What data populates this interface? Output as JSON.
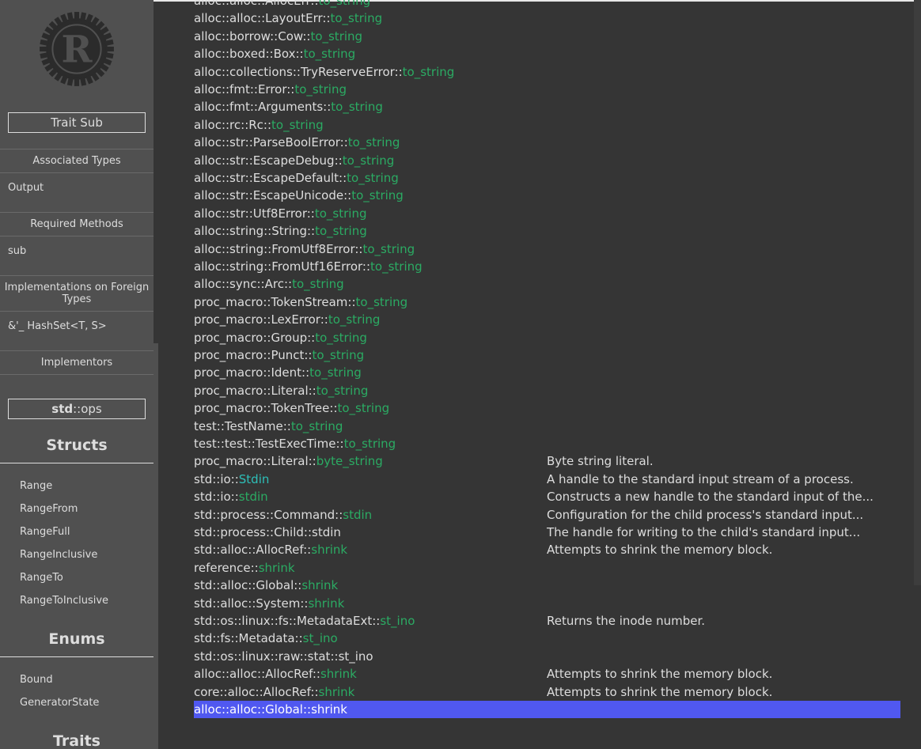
{
  "sidebar": {
    "trait_title": "Trait Sub",
    "sections": [
      {
        "heading": "Associated Types",
        "items": [
          "Output"
        ]
      },
      {
        "heading": "Required Methods",
        "items": [
          "sub"
        ]
      },
      {
        "heading": "Implementations on Foreign Types",
        "items": [
          "&'_ HashSet<T, S>"
        ]
      },
      {
        "heading": "Implementors",
        "items": []
      }
    ],
    "module_prefix": "std",
    "module_sep": "::",
    "module_name": "ops",
    "structs_heading": "Structs",
    "structs": [
      "Range",
      "RangeFrom",
      "RangeFull",
      "RangeInclusive",
      "RangeTo",
      "RangeToInclusive"
    ],
    "enums_heading": "Enums",
    "enums": [
      "Bound",
      "GeneratorState"
    ],
    "traits_heading": "Traits"
  },
  "results": [
    {
      "path": "alloc::alloc::AllocErr::",
      "name": "to_string",
      "kind": "fn",
      "desc": ""
    },
    {
      "path": "alloc::alloc::LayoutErr::",
      "name": "to_string",
      "kind": "fn",
      "desc": ""
    },
    {
      "path": "alloc::borrow::Cow::",
      "name": "to_string",
      "kind": "fn",
      "desc": ""
    },
    {
      "path": "alloc::boxed::Box::",
      "name": "to_string",
      "kind": "fn",
      "desc": ""
    },
    {
      "path": "alloc::collections::TryReserveError::",
      "name": "to_string",
      "kind": "fn",
      "desc": ""
    },
    {
      "path": "alloc::fmt::Error::",
      "name": "to_string",
      "kind": "fn",
      "desc": ""
    },
    {
      "path": "alloc::fmt::Arguments::",
      "name": "to_string",
      "kind": "fn",
      "desc": ""
    },
    {
      "path": "alloc::rc::Rc::",
      "name": "to_string",
      "kind": "fn",
      "desc": ""
    },
    {
      "path": "alloc::str::ParseBoolError::",
      "name": "to_string",
      "kind": "fn",
      "desc": ""
    },
    {
      "path": "alloc::str::EscapeDebug::",
      "name": "to_string",
      "kind": "fn",
      "desc": ""
    },
    {
      "path": "alloc::str::EscapeDefault::",
      "name": "to_string",
      "kind": "fn",
      "desc": ""
    },
    {
      "path": "alloc::str::EscapeUnicode::",
      "name": "to_string",
      "kind": "fn",
      "desc": ""
    },
    {
      "path": "alloc::str::Utf8Error::",
      "name": "to_string",
      "kind": "fn",
      "desc": ""
    },
    {
      "path": "alloc::string::String::",
      "name": "to_string",
      "kind": "fn",
      "desc": ""
    },
    {
      "path": "alloc::string::FromUtf8Error::",
      "name": "to_string",
      "kind": "fn",
      "desc": ""
    },
    {
      "path": "alloc::string::FromUtf16Error::",
      "name": "to_string",
      "kind": "fn",
      "desc": ""
    },
    {
      "path": "alloc::sync::Arc::",
      "name": "to_string",
      "kind": "fn",
      "desc": ""
    },
    {
      "path": "proc_macro::TokenStream::",
      "name": "to_string",
      "kind": "fn",
      "desc": ""
    },
    {
      "path": "proc_macro::LexError::",
      "name": "to_string",
      "kind": "fn",
      "desc": ""
    },
    {
      "path": "proc_macro::Group::",
      "name": "to_string",
      "kind": "fn",
      "desc": ""
    },
    {
      "path": "proc_macro::Punct::",
      "name": "to_string",
      "kind": "fn",
      "desc": ""
    },
    {
      "path": "proc_macro::Ident::",
      "name": "to_string",
      "kind": "fn",
      "desc": ""
    },
    {
      "path": "proc_macro::Literal::",
      "name": "to_string",
      "kind": "fn",
      "desc": ""
    },
    {
      "path": "proc_macro::TokenTree::",
      "name": "to_string",
      "kind": "fn",
      "desc": ""
    },
    {
      "path": "test::TestName::",
      "name": "to_string",
      "kind": "fn",
      "desc": ""
    },
    {
      "path": "test::test::TestExecTime::",
      "name": "to_string",
      "kind": "fn",
      "desc": ""
    },
    {
      "path": "proc_macro::Literal::",
      "name": "byte_string",
      "kind": "fn",
      "desc": "Byte string literal."
    },
    {
      "path": "std::io::",
      "name": "Stdin",
      "kind": "struct",
      "desc": "A handle to the standard input stream of a process."
    },
    {
      "path": "std::io::",
      "name": "stdin",
      "kind": "fn",
      "desc": "Constructs a new handle to the standard input of the..."
    },
    {
      "path": "std::process::Command::",
      "name": "stdin",
      "kind": "fn",
      "desc": "Configuration for the child process's standard input..."
    },
    {
      "path": "std::process::Child::",
      "name": "stdin",
      "kind": "plain",
      "desc": "The handle for writing to the child's standard input..."
    },
    {
      "path": "std::alloc::AllocRef::",
      "name": "shrink",
      "kind": "fn",
      "desc": "Attempts to shrink the memory block."
    },
    {
      "path": "reference::",
      "name": "shrink",
      "kind": "fn",
      "desc": ""
    },
    {
      "path": "std::alloc::Global::",
      "name": "shrink",
      "kind": "fn",
      "desc": ""
    },
    {
      "path": "std::alloc::System::",
      "name": "shrink",
      "kind": "fn",
      "desc": ""
    },
    {
      "path": "std::os::linux::fs::MetadataExt::",
      "name": "st_ino",
      "kind": "fn",
      "desc": "Returns the inode number."
    },
    {
      "path": "std::fs::Metadata::",
      "name": "st_ino",
      "kind": "fn",
      "desc": ""
    },
    {
      "path": "std::os::linux::raw::stat::",
      "name": "st_ino",
      "kind": "plain",
      "desc": ""
    },
    {
      "path": "alloc::alloc::AllocRef::",
      "name": "shrink",
      "kind": "fn",
      "desc": "Attempts to shrink the memory block."
    },
    {
      "path": "core::alloc::AllocRef::",
      "name": "shrink",
      "kind": "fn",
      "desc": "Attempts to shrink the memory block."
    },
    {
      "path": "alloc::alloc::Global::",
      "name": "shrink",
      "kind": "fn",
      "desc": "",
      "selected": true
    }
  ],
  "colors": {
    "background": "#353535",
    "sidebar": "#505050",
    "text": "#dddddd",
    "fn_link": "#2bab63",
    "struct_link": "#2dbfb8",
    "selected_row": "#5058f0"
  }
}
